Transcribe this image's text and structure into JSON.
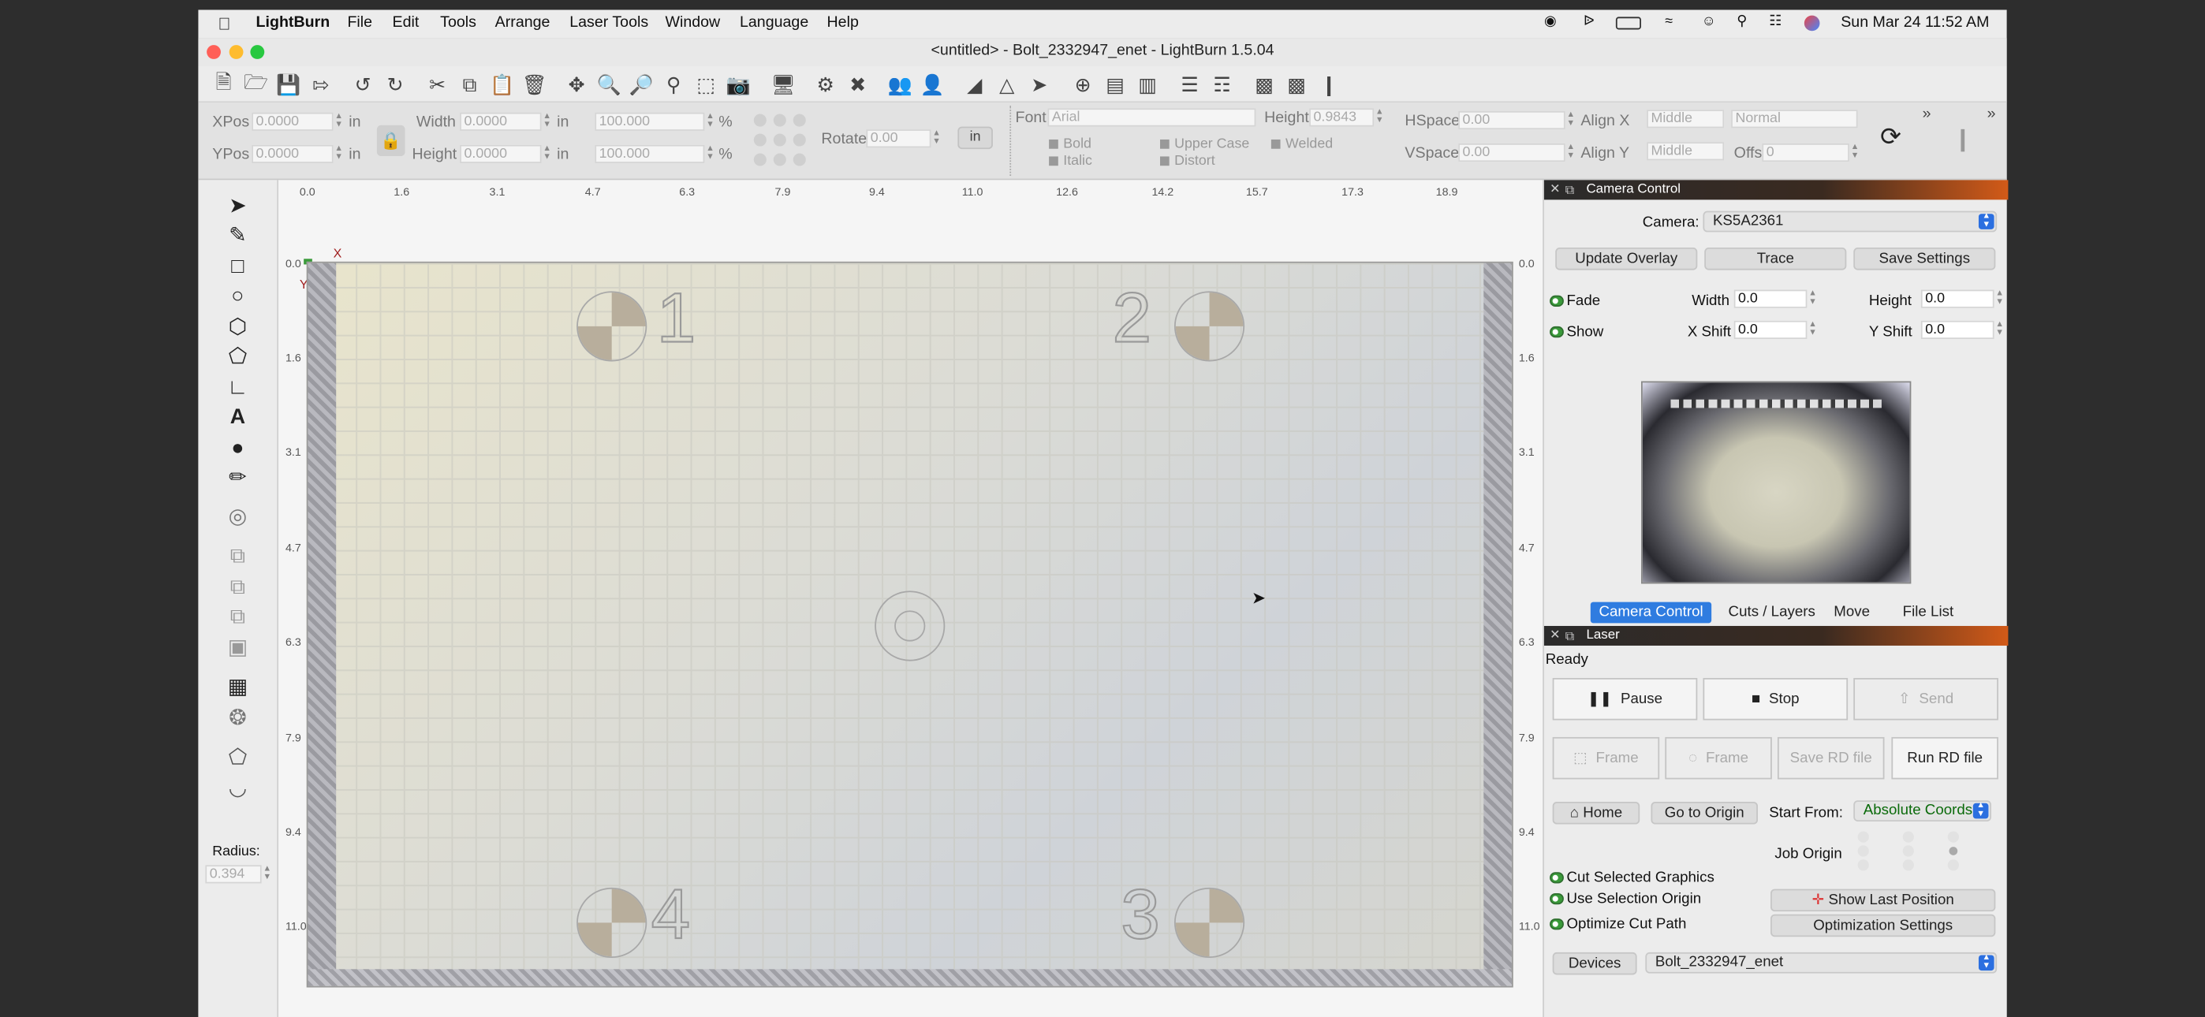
{
  "menubar": {
    "app": "LightBurn",
    "items": [
      "File",
      "Edit",
      "Tools",
      "Arrange",
      "Laser Tools",
      "Window",
      "Language",
      "Help"
    ],
    "clock": "Sun Mar 24  11:52 AM"
  },
  "window": {
    "title": "<untitled> - Bolt_2332947_enet - LightBurn 1.5.04"
  },
  "props": {
    "xpos_label": "XPos",
    "xpos": "0.0000",
    "ypos_label": "YPos",
    "ypos": "0.0000",
    "unit": "in",
    "width_label": "Width",
    "width": "0.0000",
    "height_label": "Height",
    "height": "0.0000",
    "scale_w": "100.000",
    "scale_h": "100.000",
    "pct": "%",
    "rotate_label": "Rotate",
    "rotate": "0.00",
    "in_btn": "in",
    "font_label": "Font",
    "font": "Arial",
    "fheight_label": "Height",
    "fheight": "0.9843",
    "bold": "Bold",
    "italic": "Italic",
    "upper_case": "Upper Case",
    "distort": "Distort",
    "welded": "Welded",
    "hspace_label": "HSpace",
    "hspace": "0.00",
    "vspace_label": "VSpace",
    "vspace": "0.00",
    "alignx_label": "Align X",
    "alignx": "Middle",
    "aligny_label": "Align Y",
    "aligny": "Middle",
    "normal": "Normal",
    "offset_label": "Offset",
    "offset": "0"
  },
  "lefttools": {
    "radius_label": "Radius:",
    "radius": "0.394"
  },
  "ruler": {
    "top": [
      "0.0",
      "1.6",
      "3.1",
      "4.7",
      "6.3",
      "7.9",
      "9.4",
      "11.0",
      "12.6",
      "14.2",
      "15.7",
      "17.3",
      "18.9"
    ],
    "left": [
      "0.0",
      "1.6",
      "3.1",
      "4.7",
      "6.3",
      "7.9",
      "9.4",
      "11.0"
    ],
    "x_axis": "X",
    "y_axis": "Y"
  },
  "bed_numbers": [
    "1",
    "2",
    "4",
    "3"
  ],
  "camera": {
    "title": "Camera Control",
    "camera_label": "Camera:",
    "camera_value": "KS5A2361",
    "update_overlay": "Update Overlay",
    "trace": "Trace",
    "save_settings": "Save Settings",
    "fade": "Fade",
    "show": "Show",
    "width_label": "Width",
    "width": "0.0",
    "height_label": "Height",
    "height": "0.0",
    "xshift_label": "X Shift",
    "xshift": "0.0",
    "yshift_label": "Y Shift",
    "yshift": "0.0"
  },
  "tabs": [
    "Camera Control",
    "Cuts / Layers",
    "Move",
    "File List"
  ],
  "laser": {
    "title": "Laser",
    "status": "Ready",
    "pause": "Pause",
    "stop": "Stop",
    "send": "Send",
    "frame1": "Frame",
    "frame2": "Frame",
    "save_rd": "Save RD file",
    "run_rd": "Run RD file",
    "home": "Home",
    "go_origin": "Go to Origin",
    "start_from_label": "Start From:",
    "start_from": "Absolute Coords",
    "job_origin": "Job Origin",
    "cut_selected": "Cut Selected Graphics",
    "use_selection_origin": "Use Selection Origin",
    "optimize_cut_path": "Optimize Cut Path",
    "show_last_position": "Show Last Position",
    "optimization_settings": "Optimization Settings",
    "devices": "Devices",
    "device_value": "Bolt_2332947_enet"
  },
  "colors": {
    "accent": "#2f7ce0",
    "panel_header": "#d25a18",
    "toggle_on": "#3a9a3a"
  }
}
